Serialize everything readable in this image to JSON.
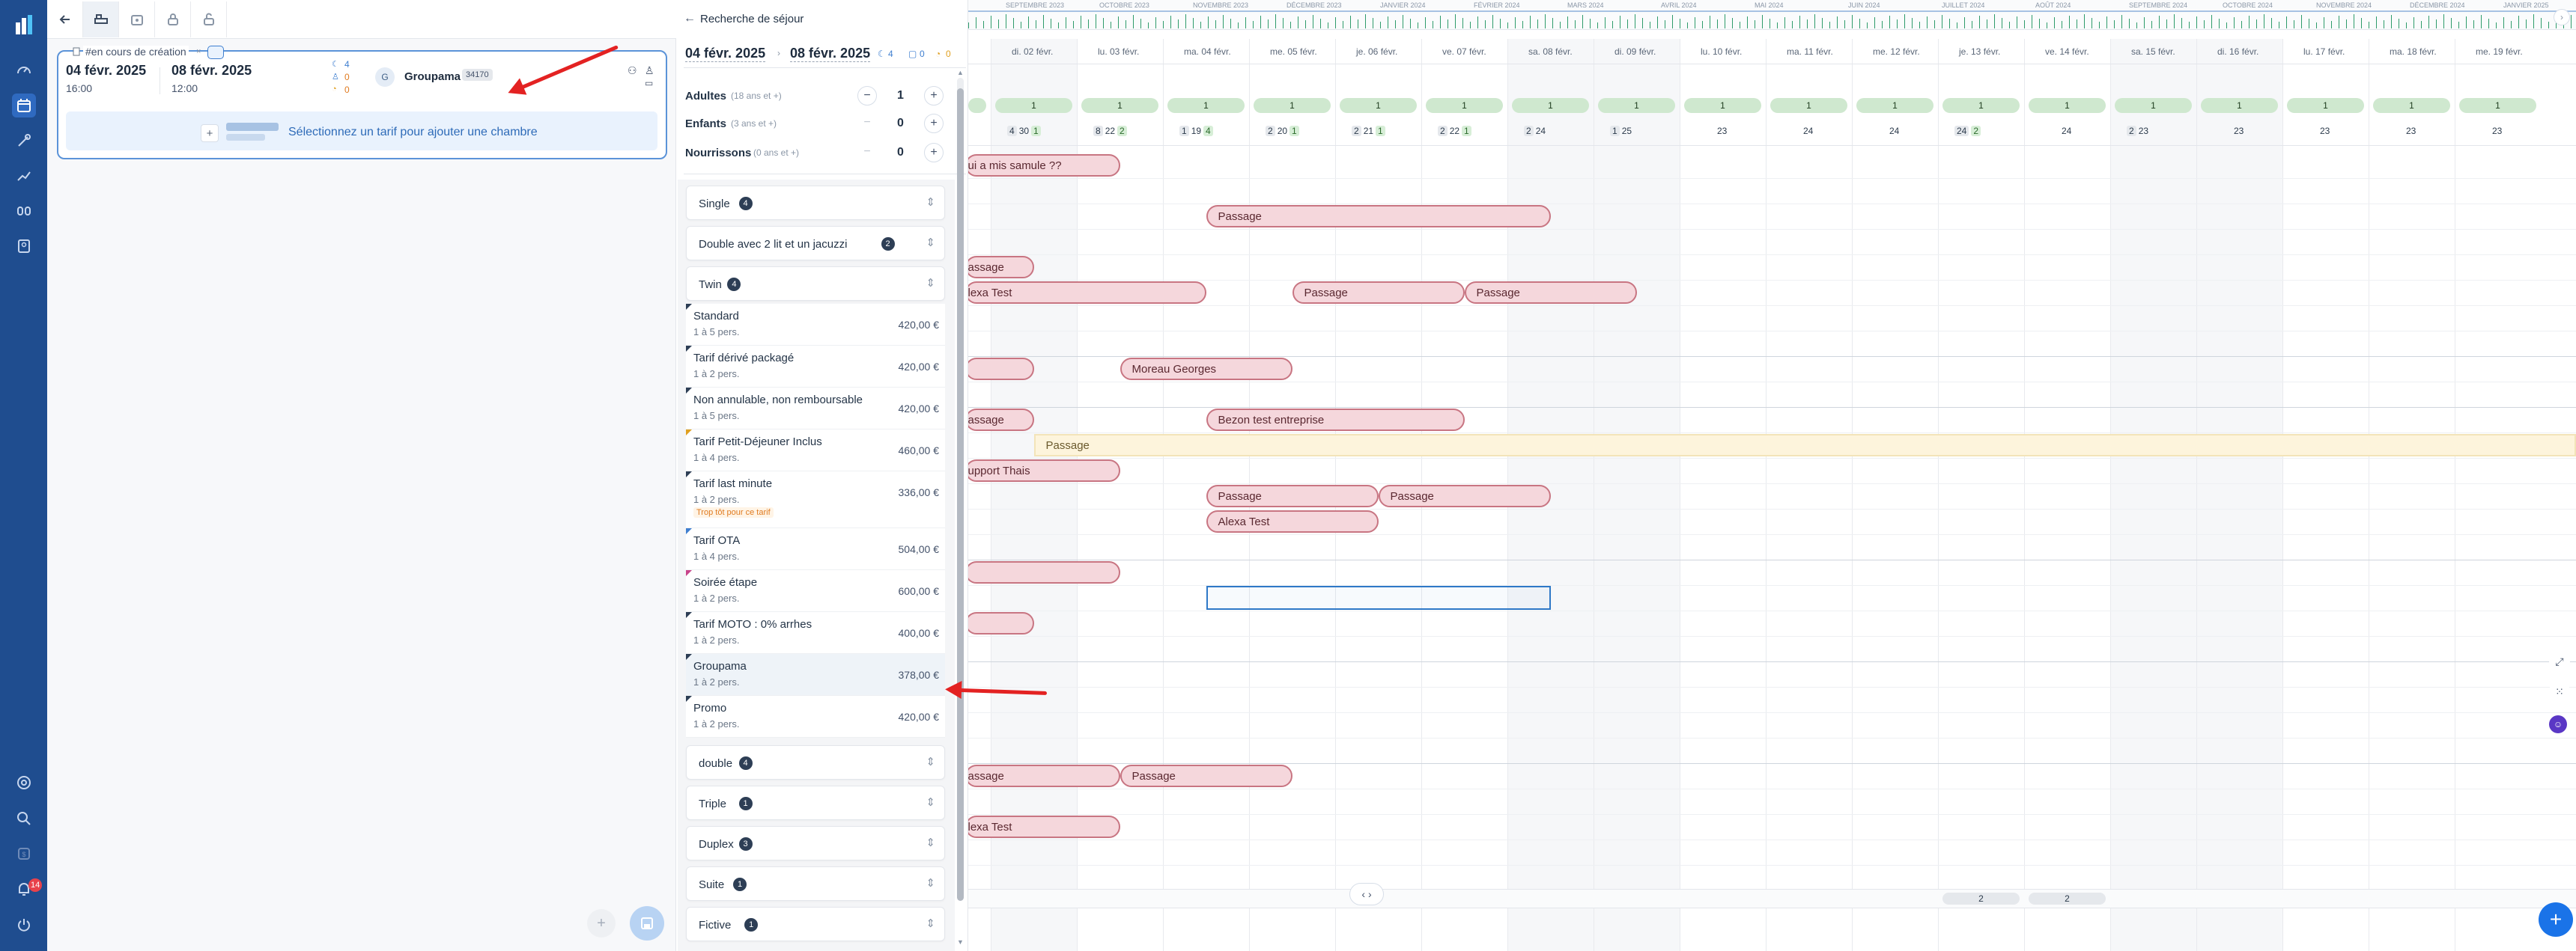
{
  "colors": {
    "nav": "#1f4d8f",
    "booking_fill": "#f5d7dc",
    "booking_border": "#c87582",
    "pill_green": "#cfe8cf",
    "selection": "#2e78c7",
    "fab": "#1a73e8",
    "annotation_arrow": "#e32222"
  },
  "top_months": [
    "SEPTEMBRE 2023",
    "OCTOBRE 2023",
    "NOVEMBRE 2023",
    "DÉCEMBRE 2023",
    "JANVIER 2024",
    "FÉVRIER 2024",
    "MARS 2024",
    "AVRIL 2024",
    "MAI 2024",
    "JUIN 2024",
    "JUILLET 2024",
    "AOÛT 2024",
    "SEPTEMBRE 2024",
    "OCTOBRE 2024",
    "NOVEMBRE 2024",
    "DÉCEMBRE 2024",
    "JANVIER 2025"
  ],
  "booking_card": {
    "status": "#en cours de création",
    "arrival_date": "04 févr. 2025",
    "arrival_time": "16:00",
    "departure_date": "08 févr. 2025",
    "departure_time": "12:00",
    "nights": "4",
    "guests_a": "0",
    "guests_b": "0",
    "client_initial": "G",
    "client_name": "Groupama",
    "client_code": "34170",
    "add_room_hint": "Sélectionnez un tarif pour ajouter une chambre"
  },
  "search": {
    "title": "Recherche de séjour",
    "date_from": "04 févr. 2025",
    "date_to": "08 févr. 2025",
    "nights": "4",
    "rooms": "0",
    "extra": "0",
    "adults_label": "Adultes",
    "adults_hint": "(18 ans et +)",
    "adults": "1",
    "children_label": "Enfants",
    "children_hint": "(3 ans et +)",
    "children": "0",
    "infants_label": "Nourrissons",
    "infants_hint": "(0 ans et +)",
    "infants": "0"
  },
  "categories_top": [
    {
      "name": "Single",
      "count": "4"
    },
    {
      "name": "Double avec 2 lit et un jacuzzi",
      "count": "2"
    },
    {
      "name": "Twin",
      "count": "4"
    }
  ],
  "rates": [
    {
      "name": "Standard",
      "sub": "1 à 5 pers.",
      "price": "420,00 €",
      "warn": ""
    },
    {
      "name": "Tarif dérivé packagé",
      "sub": "1 à 2 pers.",
      "price": "420,00 €",
      "warn": ""
    },
    {
      "name": "Non annulable, non remboursable",
      "sub": "1 à 5 pers.",
      "price": "420,00 €",
      "warn": ""
    },
    {
      "name": "Tarif Petit-Déjeuner Inclus",
      "sub": "1 à 4 pers.",
      "price": "460,00 €",
      "warn": ""
    },
    {
      "name": "Tarif last minute",
      "sub": "1 à 2 pers.",
      "price": "336,00 €",
      "warn": "Trop tôt pour ce tarif"
    },
    {
      "name": "Tarif OTA",
      "sub": "1 à 4 pers.",
      "price": "504,00 €",
      "warn": ""
    },
    {
      "name": "Soirée étape",
      "sub": "1 à 2 pers.",
      "price": "600,00 €",
      "warn": ""
    },
    {
      "name": "Tarif MOTO : 0% arrhes",
      "sub": "1 à 2 pers.",
      "price": "400,00 €",
      "warn": ""
    },
    {
      "name": "Groupama",
      "sub": "1 à 2 pers.",
      "price": "378,00 €",
      "warn": ""
    },
    {
      "name": "Promo",
      "sub": "1 à 2 pers.",
      "price": "420,00 €",
      "warn": ""
    }
  ],
  "categories_bottom": [
    {
      "name": "double",
      "count": "4"
    },
    {
      "name": "Triple",
      "count": "1"
    },
    {
      "name": "Duplex",
      "count": "3"
    },
    {
      "name": "Suite",
      "count": "1"
    },
    {
      "name": "Fictive",
      "count": "1"
    }
  ],
  "grid": {
    "days": [
      "di. 02 févr.",
      "lu. 03 févr.",
      "ma. 04 févr.",
      "me. 05 févr.",
      "je. 06 févr.",
      "ve. 07 févr.",
      "sa. 08 févr.",
      "di. 09 févr.",
      "lu. 10 févr.",
      "ma. 11 févr.",
      "me. 12 févr.",
      "je. 13 févr.",
      "ve. 14 févr.",
      "sa. 15 févr.",
      "di. 16 févr.",
      "lu. 17 févr.",
      "ma. 18 févr.",
      "me. 19 févr."
    ],
    "pill": "1",
    "day_counts": [
      [
        "4",
        "30",
        "1"
      ],
      [
        "8",
        "22",
        "2"
      ],
      [
        "1",
        "19",
        "4"
      ],
      [
        "2",
        "20",
        "1"
      ],
      [
        "2",
        "21",
        "1"
      ],
      [
        "2",
        "22",
        "1"
      ],
      [
        "2",
        "24"
      ],
      [
        "1",
        "25"
      ],
      [
        "23"
      ],
      [
        "24"
      ],
      [
        "24"
      ],
      [
        "24",
        "2"
      ],
      [
        "24"
      ],
      [
        "2",
        "23"
      ],
      [
        "23"
      ],
      [
        "23"
      ],
      [
        "23"
      ],
      [
        "23"
      ]
    ],
    "bottom_counts": [
      {
        "day": 11,
        "v": "2"
      },
      {
        "day": 12,
        "v": "2"
      }
    ],
    "bookings": [
      {
        "label": "ui a mis samule ??",
        "x0": -0.3,
        "x1": 1.5,
        "row": 0
      },
      {
        "label": "Passage",
        "x0": 2.5,
        "x1": 6.5,
        "row": 2
      },
      {
        "label": "assage",
        "x0": -0.3,
        "x1": 0.5,
        "row": 4
      },
      {
        "label": "lexa Test",
        "x0": -0.3,
        "x1": 2.5,
        "row": 5
      },
      {
        "label": "Passage",
        "x0": 3.5,
        "x1": 5.5,
        "row": 5
      },
      {
        "label": "Passage",
        "x0": 5.5,
        "x1": 7.5,
        "row": 5
      },
      {
        "label": "",
        "x0": -0.3,
        "x1": 0.5,
        "row": 8
      },
      {
        "label": "Moreau Georges",
        "x0": 1.5,
        "x1": 3.5,
        "row": 8
      },
      {
        "label": "assage",
        "x0": -0.3,
        "x1": 0.5,
        "row": 10
      },
      {
        "label": "Bezon test entreprise",
        "x0": 2.5,
        "x1": 5.5,
        "row": 10
      },
      {
        "label": "upport Thais",
        "x0": -0.3,
        "x1": 1.5,
        "row": 12
      },
      {
        "label": "Passage",
        "x0": 2.5,
        "x1": 4.5,
        "row": 13
      },
      {
        "label": "Passage",
        "x0": 4.5,
        "x1": 6.5,
        "row": 13
      },
      {
        "label": "Alexa Test",
        "x0": 2.5,
        "x1": 4.5,
        "row": 14
      },
      {
        "label": "",
        "x0": -0.3,
        "x1": 1.5,
        "row": 16
      },
      {
        "label": "",
        "x0": -0.3,
        "x1": 0.5,
        "row": 18
      },
      {
        "label": "assage",
        "x0": -0.3,
        "x1": 1.5,
        "row": 24
      },
      {
        "label": "Passage",
        "x0": 1.5,
        "x1": 3.5,
        "row": 24
      },
      {
        "label": "lexa Test",
        "x0": -0.3,
        "x1": 1.5,
        "row": 26
      }
    ],
    "long_booking": {
      "label": "Passage",
      "x0": 0.5,
      "row": 11
    },
    "selection": {
      "x0": 2.5,
      "x1": 6.5,
      "row": 17
    }
  },
  "nav_badge": "14"
}
